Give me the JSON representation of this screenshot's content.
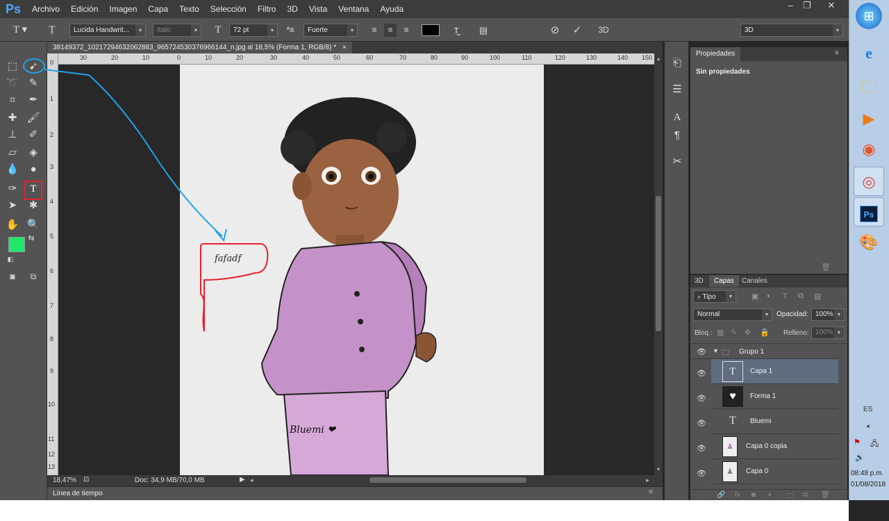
{
  "app": {
    "logo": "Ps"
  },
  "menu": [
    "Archivo",
    "Edición",
    "Imagen",
    "Capa",
    "Texto",
    "Selección",
    "Filtro",
    "3D",
    "Vista",
    "Ventana",
    "Ayuda"
  ],
  "window_controls": {
    "minimize": "–",
    "restore": "❐",
    "close": "✕"
  },
  "options": {
    "font_family": "Lucida Handwrit...",
    "font_style": "Italic",
    "font_size": "72 pt",
    "aa_label": "ªa",
    "antialias": "Fuerte",
    "mode_3d": "3D",
    "workspace": "3D",
    "text_color": "#000000"
  },
  "document": {
    "tab_title": "38149372_10217294632062883_965724530376966144_n.jpg al 18,5% (Forma 1, RGB/8) *",
    "zoom": "18,47%",
    "doc_size": "Doc: 34,9 MB/70,0 MB",
    "text_layer_preview": "fafadf",
    "signature": "Bluemi"
  },
  "rulers": {
    "h": [
      "30",
      "20",
      "10",
      "0",
      "10",
      "20",
      "30",
      "40",
      "50",
      "60",
      "70",
      "80",
      "90",
      "100",
      "110",
      "120",
      "130",
      "140",
      "150"
    ],
    "v": [
      "0",
      "1",
      "2",
      "3",
      "4",
      "5",
      "6",
      "7",
      "8",
      "9",
      "10",
      "11",
      "12",
      "13"
    ]
  },
  "colors": {
    "foreground": "#1fe86a",
    "background": "#ffffff",
    "annotation_blue": "#1fa3e8",
    "annotation_red": "#e8202a",
    "selection": "#5e6d80"
  },
  "timeline": {
    "label": "Línea de tiempo"
  },
  "properties": {
    "tab": "Propiedades",
    "content": "Sin propiedades"
  },
  "layers": {
    "tabs": [
      "3D",
      "Capas",
      "Canales"
    ],
    "filter": "Tipo",
    "blend_mode": "Normal",
    "opacity_label": "Opacidad:",
    "opacity": "100%",
    "lock_label": "Bloq.:",
    "fill_label": "Relleno:",
    "fill": "100%",
    "items": [
      {
        "name": "Grupo 1",
        "kind": "group"
      },
      {
        "name": "Capa 1",
        "kind": "text",
        "selected": true
      },
      {
        "name": "Forma 1",
        "kind": "shape"
      },
      {
        "name": "Bluemi",
        "kind": "text"
      },
      {
        "name": "Capa 0 copia",
        "kind": "image"
      },
      {
        "name": "Capa 0",
        "kind": "image"
      }
    ]
  },
  "taskbar": {
    "lang": "ES",
    "time": "08:48 p.m.",
    "date": "01/08/2018",
    "apps": [
      "windows-orb",
      "internet-explorer",
      "file-explorer",
      "media-player",
      "firefox",
      "chrome",
      "photoshop",
      "paint"
    ]
  }
}
